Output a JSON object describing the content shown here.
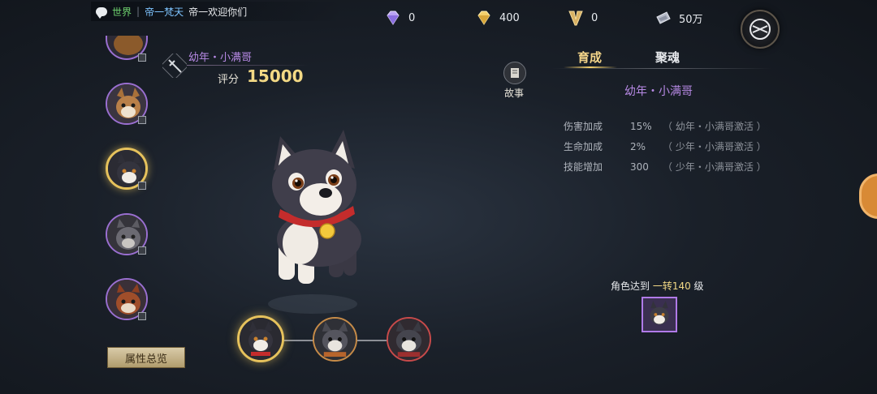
{
  "chat": {
    "channel": "世界",
    "sep": "|",
    "sender": "帝一梵天",
    "message": "帝一欢迎你们"
  },
  "currencies": [
    {
      "icon": "purple-diamond-icon",
      "value": "0"
    },
    {
      "icon": "gold-diamond-icon",
      "value": "400"
    },
    {
      "icon": "v-currency-icon",
      "value": "0"
    },
    {
      "icon": "silver-ticket-icon",
      "value": "50万"
    }
  ],
  "pet": {
    "name": "幼年・小满哥",
    "score_label": "评分",
    "score_value": "15000"
  },
  "attr_button": "属性总览",
  "story_label": "故事",
  "tabs": [
    {
      "label": "育成",
      "active": true
    },
    {
      "label": "聚魂",
      "active": false
    }
  ],
  "detail": {
    "name": "幼年・小满哥",
    "stats": [
      {
        "label": "伤害加成",
        "value": "15%",
        "cond": "（ 幼年・小满哥激活 ）"
      },
      {
        "label": "生命加成",
        "value": "2%",
        "cond": "（ 少年・小满哥激活 ）"
      },
      {
        "label": "技能增加",
        "value": "300",
        "cond": "（ 少年・小满哥激活 ）"
      }
    ],
    "req_prefix": "角色达到 ",
    "req_level": "一转140",
    "req_suffix": " 级"
  },
  "colors": {
    "accent_gold": "#f3d985",
    "rarity_purple": "#b88ae6"
  }
}
